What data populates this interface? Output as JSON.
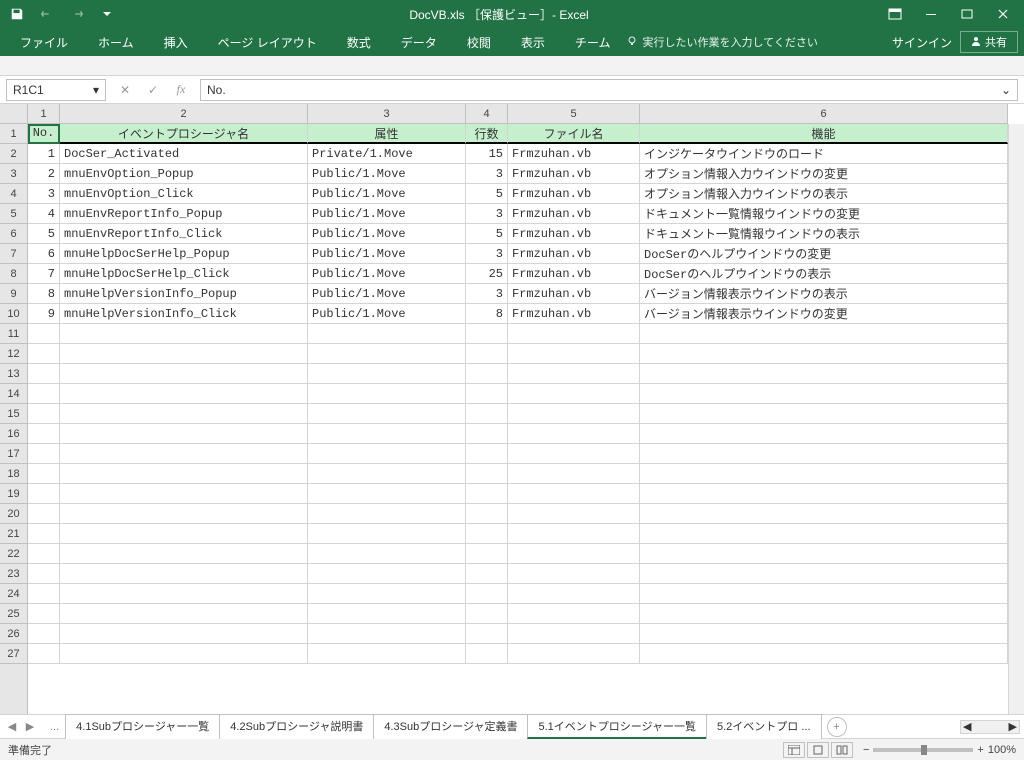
{
  "title": "DocVB.xls ［保護ビュー］- Excel",
  "qat": {
    "undo_disabled": true,
    "redo_disabled": true
  },
  "ribbon": {
    "tabs": [
      "ファイル",
      "ホーム",
      "挿入",
      "ページ レイアウト",
      "数式",
      "データ",
      "校閲",
      "表示",
      "チーム"
    ],
    "tell_me": "実行したい作業を入力してください",
    "signin": "サインイン",
    "share": "共有"
  },
  "name_box": "R1C1",
  "formula": "No.",
  "col_headers": [
    "1",
    "2",
    "3",
    "4",
    "5",
    "6"
  ],
  "row_headers": [
    "1",
    "2",
    "3",
    "4",
    "5",
    "6",
    "7",
    "8",
    "9",
    "10",
    "11",
    "12",
    "13",
    "14",
    "15",
    "16",
    "17",
    "18",
    "19",
    "20",
    "21",
    "22",
    "23",
    "24",
    "25",
    "26",
    "27"
  ],
  "headers": [
    "No.",
    "イベントプロシージャ名",
    "属性",
    "行数",
    "ファイル名",
    "機能"
  ],
  "rows": [
    {
      "no": 1,
      "name": "DocSer_Activated",
      "attr": "Private/1.Move",
      "lines": 15,
      "file": "Frmzuhan.vb",
      "func": "インジケータウインドウのロード"
    },
    {
      "no": 2,
      "name": "mnuEnvOption_Popup",
      "attr": "Public/1.Move",
      "lines": 3,
      "file": "Frmzuhan.vb",
      "func": "オプション情報入力ウインドウの変更"
    },
    {
      "no": 3,
      "name": "mnuEnvOption_Click",
      "attr": "Public/1.Move",
      "lines": 5,
      "file": "Frmzuhan.vb",
      "func": "オプション情報入力ウインドウの表示"
    },
    {
      "no": 4,
      "name": "mnuEnvReportInfo_Popup",
      "attr": "Public/1.Move",
      "lines": 3,
      "file": "Frmzuhan.vb",
      "func": "ドキュメント一覧情報ウインドウの変更"
    },
    {
      "no": 5,
      "name": "mnuEnvReportInfo_Click",
      "attr": "Public/1.Move",
      "lines": 5,
      "file": "Frmzuhan.vb",
      "func": "ドキュメント一覧情報ウインドウの表示"
    },
    {
      "no": 6,
      "name": "mnuHelpDocSerHelp_Popup",
      "attr": "Public/1.Move",
      "lines": 3,
      "file": "Frmzuhan.vb",
      "func": "DocSerのヘルプウインドウの変更"
    },
    {
      "no": 7,
      "name": "mnuHelpDocSerHelp_Click",
      "attr": "Public/1.Move",
      "lines": 25,
      "file": "Frmzuhan.vb",
      "func": "DocSerのヘルプウインドウの表示"
    },
    {
      "no": 8,
      "name": "mnuHelpVersionInfo_Popup",
      "attr": "Public/1.Move",
      "lines": 3,
      "file": "Frmzuhan.vb",
      "func": "バージョン情報表示ウインドウの表示"
    },
    {
      "no": 9,
      "name": "mnuHelpVersionInfo_Click",
      "attr": "Public/1.Move",
      "lines": 8,
      "file": "Frmzuhan.vb",
      "func": "バージョン情報表示ウインドウの変更"
    }
  ],
  "sheet_tabs": {
    "ellipsis": "...",
    "tabs": [
      {
        "label": "4.1Subプロシージャー一覧",
        "active": false
      },
      {
        "label": "4.2Subプロシージャ説明書",
        "active": false
      },
      {
        "label": "4.3Subプロシージャ定義書",
        "active": false
      },
      {
        "label": "5.1イベントプロシージャー一覧",
        "active": true
      },
      {
        "label": "5.2イベントプロ ...",
        "active": false
      }
    ]
  },
  "status": {
    "ready": "準備完了",
    "zoom": "100%"
  },
  "colors": {
    "accent": "#217346",
    "header_fill": "#c6efce"
  }
}
